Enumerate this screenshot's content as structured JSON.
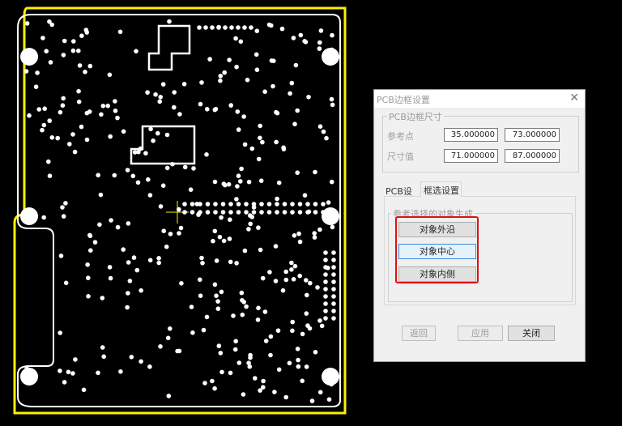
{
  "dialog": {
    "title": "PCB边框设置",
    "close_glyph": "✕",
    "size_group": {
      "label": "PCB边框尺寸",
      "ref_label": "参考点",
      "ref_x": "35.000000",
      "ref_y": "73.000000",
      "size_label": "尺寸值",
      "size_w": "71.000000",
      "size_h": "87.000000"
    },
    "tabs": [
      {
        "label": "PCB设置",
        "active": false
      },
      {
        "label": "框选设置",
        "active": true
      }
    ],
    "gen_group": {
      "label": "参考选择的对象生成",
      "buttons": [
        "对象外沿",
        "对象中心",
        "对象内侧"
      ]
    },
    "footer": {
      "back": "返回",
      "apply": "应用",
      "close": "关闭"
    }
  },
  "colors": {
    "board_outline": "#ffee00",
    "pad": "#ffffff",
    "highlight": "#e01010"
  }
}
